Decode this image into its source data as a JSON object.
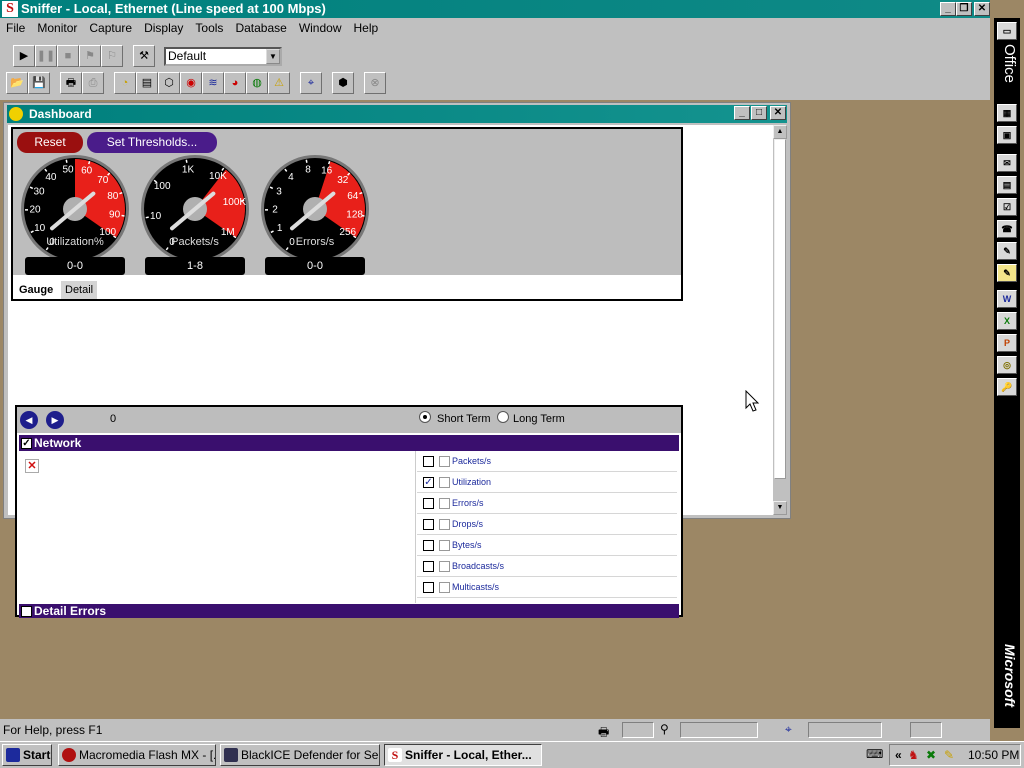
{
  "window": {
    "title": "Sniffer - Local, Ethernet (Line speed at 100 Mbps)",
    "app_icon_letter": "S",
    "minimize": "_",
    "restore": "❐",
    "close": "✕"
  },
  "menu": [
    "File",
    "Monitor",
    "Capture",
    "Display",
    "Tools",
    "Database",
    "Window",
    "Help"
  ],
  "toolbar": {
    "profile_select": "Default"
  },
  "dashboard": {
    "title": "Dashboard",
    "reset_label": "Reset",
    "thresholds_label": "Set Thresholds...",
    "gauges": [
      {
        "label": "Utilization%",
        "value": "0-0",
        "ticks": [
          "0",
          "10",
          "20",
          "30",
          "40",
          "50",
          "60",
          "70",
          "80",
          "90",
          "100"
        ]
      },
      {
        "label": "Packets/s",
        "value": "1-8",
        "ticks": [
          "0",
          "10",
          "100",
          "1K",
          "10K",
          "100K",
          "1M"
        ]
      },
      {
        "label": "Errors/s",
        "value": "0-0",
        "ticks": [
          "0",
          "1",
          "2",
          "3",
          "4",
          "8",
          "16",
          "32",
          "64",
          "128",
          "256"
        ]
      }
    ],
    "tabs": [
      "Gauge",
      "Detail"
    ],
    "counter": "0",
    "short_term": "Short Term",
    "long_term": "Long Term",
    "network_label": "Network",
    "detail_errors_label": "Detail Errors",
    "metrics": [
      {
        "label": "Packets/s",
        "checked": false
      },
      {
        "label": "Utilization",
        "checked": true
      },
      {
        "label": "Errors/s",
        "checked": false
      },
      {
        "label": "Drops/s",
        "checked": false
      },
      {
        "label": "Bytes/s",
        "checked": false
      },
      {
        "label": "Broadcasts/s",
        "checked": false
      },
      {
        "label": "Multicasts/s",
        "checked": false
      }
    ]
  },
  "office": {
    "label": "Office",
    "brand": "Microsoft"
  },
  "status": {
    "help_text": "For Help, press F1"
  },
  "taskbar": {
    "start": "Start",
    "tasks": [
      "Macromedia Flash MX - [...",
      "BlackICE Defender for Se...",
      "Sniffer - Local, Ether..."
    ],
    "clock": "10:50 PM"
  },
  "colors": {
    "titlebar": "#00807d",
    "desktop": "#9c8765",
    "gauge_red": "#e8201a",
    "network_bar": "#3a0f6e",
    "reset_button": "#9a0f0f",
    "threshold_button": "#4a1c8a"
  }
}
